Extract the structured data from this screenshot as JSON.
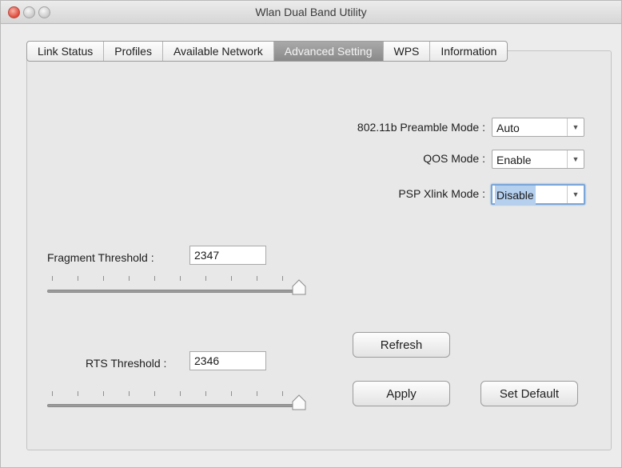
{
  "window": {
    "title": "Wlan Dual Band Utility"
  },
  "tabs": [
    {
      "label": "Link Status"
    },
    {
      "label": "Profiles"
    },
    {
      "label": "Available Network"
    },
    {
      "label": "Advanced Setting",
      "active": true
    },
    {
      "label": "WPS"
    },
    {
      "label": "Information"
    }
  ],
  "settings": {
    "preamble": {
      "label": "802.11b  Preamble Mode :",
      "value": "Auto"
    },
    "qos": {
      "label": "QOS Mode :",
      "value": "Enable"
    },
    "psp": {
      "label": "PSP Xlink Mode :",
      "value": "Disable"
    }
  },
  "fragment": {
    "label": "Fragment Threshold :",
    "value": "2347",
    "slider_level": 1.0
  },
  "rts": {
    "label": "RTS Threshold :",
    "value": "2346",
    "slider_level": 1.0
  },
  "buttons": {
    "refresh": "Refresh",
    "apply": "Apply",
    "set_default": "Set Default"
  },
  "colors": {
    "active_tab": "#8f8f8f",
    "focus_ring": "#7aa6d9"
  }
}
